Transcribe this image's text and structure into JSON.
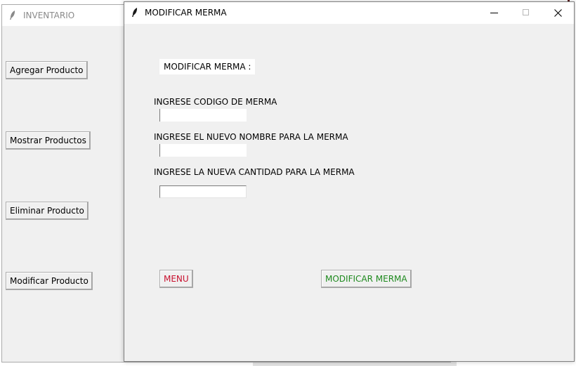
{
  "back_window": {
    "title": "INVENTARIO",
    "buttons": [
      {
        "label": "Agregar Producto"
      },
      {
        "label": "Mostrar Productos"
      },
      {
        "label": "Eliminar Producto"
      },
      {
        "label": "Modificar Producto"
      }
    ]
  },
  "dialog": {
    "title": "MODIFICAR MERMA",
    "section_title": "MODIFICAR MERMA :",
    "fields": [
      {
        "label": "INGRESE CODIGO DE MERMA",
        "value": ""
      },
      {
        "label": "INGRESE EL NUEVO NOMBRE PARA LA MERMA",
        "value": ""
      },
      {
        "label": "INGRESE LA NUEVA CANTIDAD PARA LA MERMA",
        "value": ""
      }
    ],
    "menu_button": "MENU",
    "submit_button": "MODIFICAR MERMA"
  },
  "colors": {
    "menu_text": "#c8102e",
    "submit_text": "#1e8a1e",
    "window_bg": "#f0f0f0"
  },
  "icons": {
    "app_icon": "feather-icon",
    "minimize": "minimize-icon",
    "maximize": "maximize-icon",
    "close": "close-icon"
  }
}
